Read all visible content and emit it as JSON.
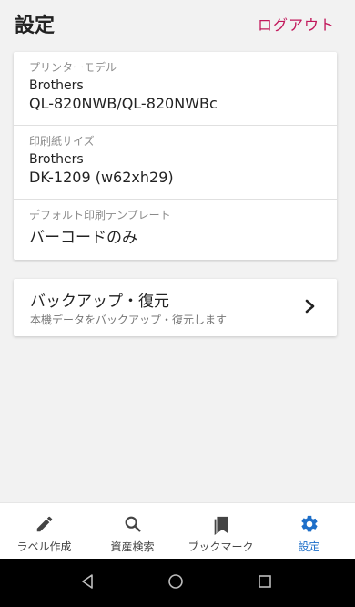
{
  "header": {
    "title": "設定",
    "logout_label": "ログアウト"
  },
  "settings": {
    "printer_model": {
      "label": "プリンターモデル",
      "line1": "Brothers",
      "line2": "QL-820NWB/QL-820NWBc"
    },
    "paper_size": {
      "label": "印刷紙サイズ",
      "line1": "Brothers",
      "line2": "DK-1209 (w62xh29)"
    },
    "default_template": {
      "label": "デフォルト印刷テンプレート",
      "value": "バーコードのみ"
    }
  },
  "backup": {
    "title": "バックアップ・復元",
    "subtitle": "本機データをバックアップ・復元します"
  },
  "bottom_nav": {
    "items": [
      {
        "label": "ラベル作成",
        "icon": "pencil-icon"
      },
      {
        "label": "資産検索",
        "icon": "search-icon"
      },
      {
        "label": "ブックマーク",
        "icon": "bookmark-icon"
      },
      {
        "label": "設定",
        "icon": "gear-icon"
      }
    ],
    "active_index": 3
  },
  "colors": {
    "accent": "#c2185b",
    "active_nav": "#1e6fc9",
    "background": "#f2f2f2"
  }
}
